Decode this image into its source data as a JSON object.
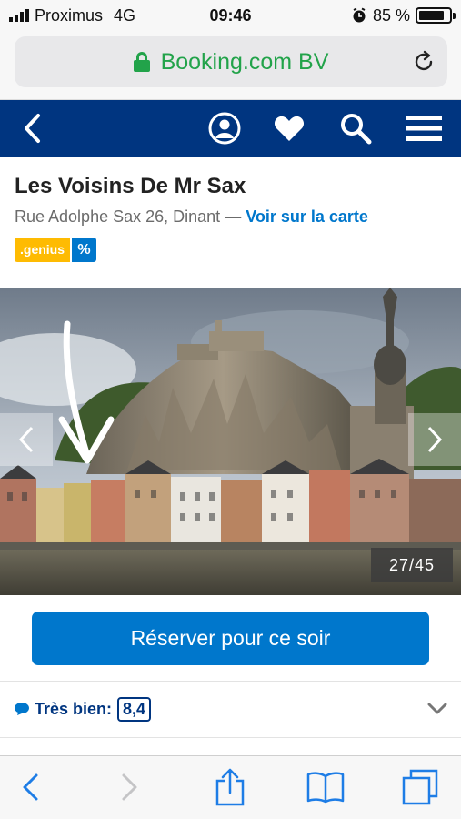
{
  "status_bar": {
    "carrier": "Proximus",
    "network": "4G",
    "time": "09:46",
    "battery": "85 %",
    "battery_level": 0.85
  },
  "browser": {
    "url_label": "Booking.com BV",
    "secure_icon": "lock-icon",
    "reload_icon": "reload-icon"
  },
  "nav": {
    "back_icon": "back-arrow-icon",
    "account_icon": "account-icon",
    "favorites_icon": "heart-icon",
    "search_icon": "search-icon",
    "menu_icon": "hamburger-menu-icon"
  },
  "hotel": {
    "name": "Les Voisins De Mr Sax",
    "address": "Rue Adolphe Sax 26, Dinant",
    "separator": "—",
    "map_link": "Voir sur la carte",
    "genius_label": ".genius",
    "discount_label": "%"
  },
  "gallery": {
    "counter": "27/45",
    "prev_icon": "chevron-left-icon",
    "next_icon": "chevron-right-icon"
  },
  "reserve": {
    "button_label": "Réserver pour ce soir"
  },
  "review": {
    "label": "Très bien:",
    "score": "8,4"
  },
  "toolbar": {
    "icons": [
      "back-icon",
      "forward-icon",
      "share-icon",
      "bookmarks-icon",
      "tabs-icon"
    ]
  },
  "colors": {
    "nav_blue": "#003580",
    "action_blue": "#0077cc",
    "genius_yellow": "#febb02",
    "secure_green": "#22a34a"
  }
}
